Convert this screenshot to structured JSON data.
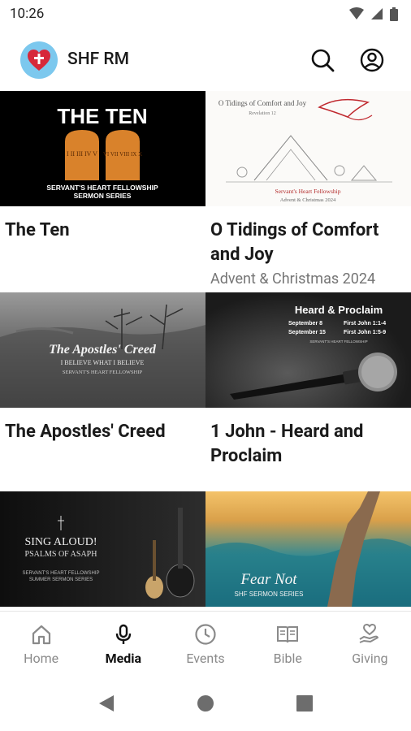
{
  "status": {
    "time": "10:26"
  },
  "app": {
    "title": "SHF RM"
  },
  "cards": [
    {
      "title": "The Ten",
      "subtitle": "",
      "art": {
        "headline": "THE TEN",
        "line1": "SERVANT'S HEART FELLOWSHIP",
        "line2": "SERMON SERIES",
        "tablet_left": "I II III IV V",
        "tablet_right": "VI VII VIII IX X"
      }
    },
    {
      "title": "O Tidings of Comfort and Joy",
      "subtitle": "Advent & Christmas 2024",
      "art": {
        "headline": "O Tidings of Comfort and Joy",
        "ref": "Revelation 12",
        "org": "Servant's Heart Fellowship",
        "series": "Advent & Christmas 2024"
      }
    },
    {
      "title": "The Apostles' Creed",
      "subtitle": "",
      "art": {
        "headline": "The Apostles' Creed",
        "line1": "I BELIEVE WHAT I BELIEVE",
        "line2": "SERVANT'S HEART FELLOWSHIP"
      }
    },
    {
      "title": "1 John - Heard and Proclaim",
      "subtitle": "",
      "art": {
        "headline": "Heard & Proclaim",
        "row1_date": "September 8",
        "row1_ref": "First John 1:1-4",
        "row2_date": "September 15",
        "row2_ref": "First John 1:5-9",
        "org": "SERVANT'S HEART FELLOWSHIP"
      }
    },
    {
      "title": "",
      "subtitle": "",
      "art": {
        "headline": "SING ALOUD!",
        "line1": "PSALMS OF ASAPH",
        "line2": "SERVANT'S HEART FELLOWSHIP",
        "line3": "SUMMER SERMON SERIES"
      }
    },
    {
      "title": "",
      "subtitle": "",
      "art": {
        "headline": "Fear Not",
        "line1": "SHF SERMON SERIES"
      }
    }
  ],
  "nav": [
    {
      "label": "Home",
      "icon": "home-icon",
      "active": false
    },
    {
      "label": "Media",
      "icon": "microphone-icon",
      "active": true
    },
    {
      "label": "Events",
      "icon": "clock-icon",
      "active": false
    },
    {
      "label": "Bible",
      "icon": "book-icon",
      "active": false
    },
    {
      "label": "Giving",
      "icon": "heart-hand-icon",
      "active": false
    }
  ],
  "colors": {
    "accent": "#7cc8ee",
    "brand_red": "#d6283a",
    "active_nav": "#111111",
    "inactive_nav": "#8a8a8a"
  }
}
